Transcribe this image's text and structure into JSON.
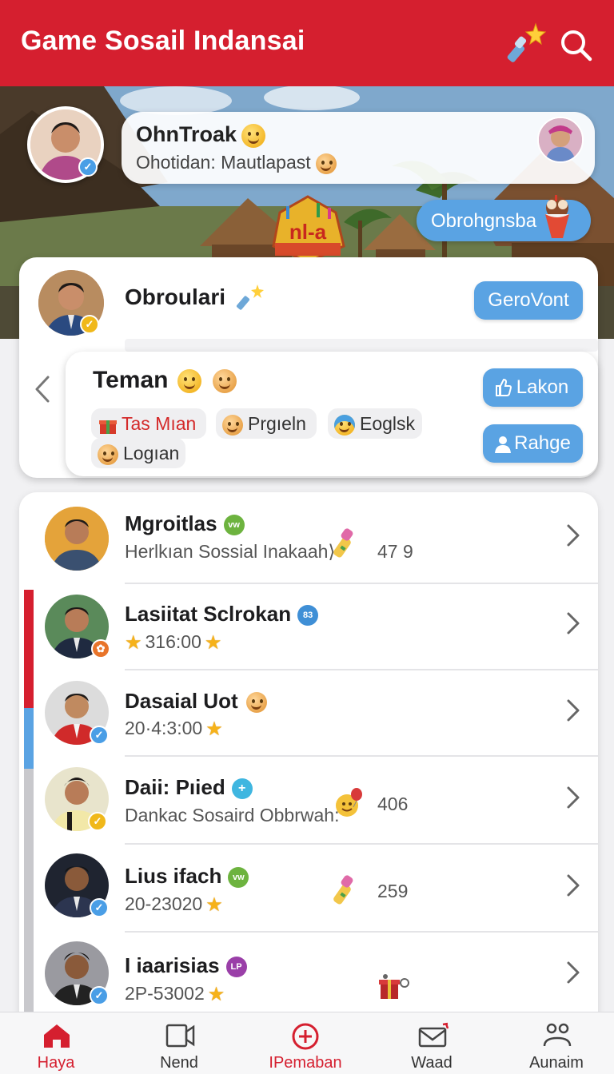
{
  "app": {
    "title": "Game Sosail Indansai"
  },
  "hero": {
    "post_name": "OhnTroak",
    "post_message": "Ohotidan: Mautlapast",
    "logo_text": "nl-a",
    "pill_label": "Obrohgnsba"
  },
  "featured": {
    "name": "Obroulari",
    "follow_label": "GeroVont"
  },
  "friends_card": {
    "title": "Teman",
    "chips": [
      "Tas Mıan",
      "Prgıeln",
      "Eoglsk",
      "Logıan"
    ],
    "like_label": "Lakon",
    "share_label": "Rahge"
  },
  "list": [
    {
      "name": "Mgroitlas",
      "badge": "vw",
      "badge_color": "#6db33f",
      "subtitle": "Herlkıan Sossial Inakaah⟩",
      "count": "47 9",
      "icon": "wand-icon"
    },
    {
      "name": "Lasiitat Sclrokan",
      "badge": "83",
      "badge_color": "#3f8fd6",
      "subtitle": "316:00",
      "count": "",
      "icon": ""
    },
    {
      "name": "Dasaial Uot",
      "badge": "",
      "badge_color": "",
      "subtitle": "20·4:3:00",
      "count": "",
      "icon": ""
    },
    {
      "name": "Daii: Pıied",
      "badge": "+",
      "badge_color": "#3fb6e0",
      "subtitle": "Dankac Sosaird Obbrwah:",
      "count": "406",
      "icon": "balloon-emoji-icon"
    },
    {
      "name": "Lius ifach",
      "badge": "vw",
      "badge_color": "#6db33f",
      "subtitle": "20-23020",
      "count": "259",
      "icon": "wand-icon"
    },
    {
      "name": "I iaarisias",
      "badge": "LP",
      "badge_color": "#9a3fa8",
      "subtitle": "2P-53002",
      "count": "",
      "icon": "gift-icon"
    }
  ],
  "bottom_nav": [
    {
      "label": "Haya",
      "active": true
    },
    {
      "label": "Nend",
      "active": false
    },
    {
      "label": "IPemaban",
      "active": false
    },
    {
      "label": "Waad",
      "active": false
    },
    {
      "label": "Aunaim",
      "active": false
    }
  ],
  "colors": {
    "primary": "#d51f2f",
    "accent_blue": "#5aa3e3"
  }
}
